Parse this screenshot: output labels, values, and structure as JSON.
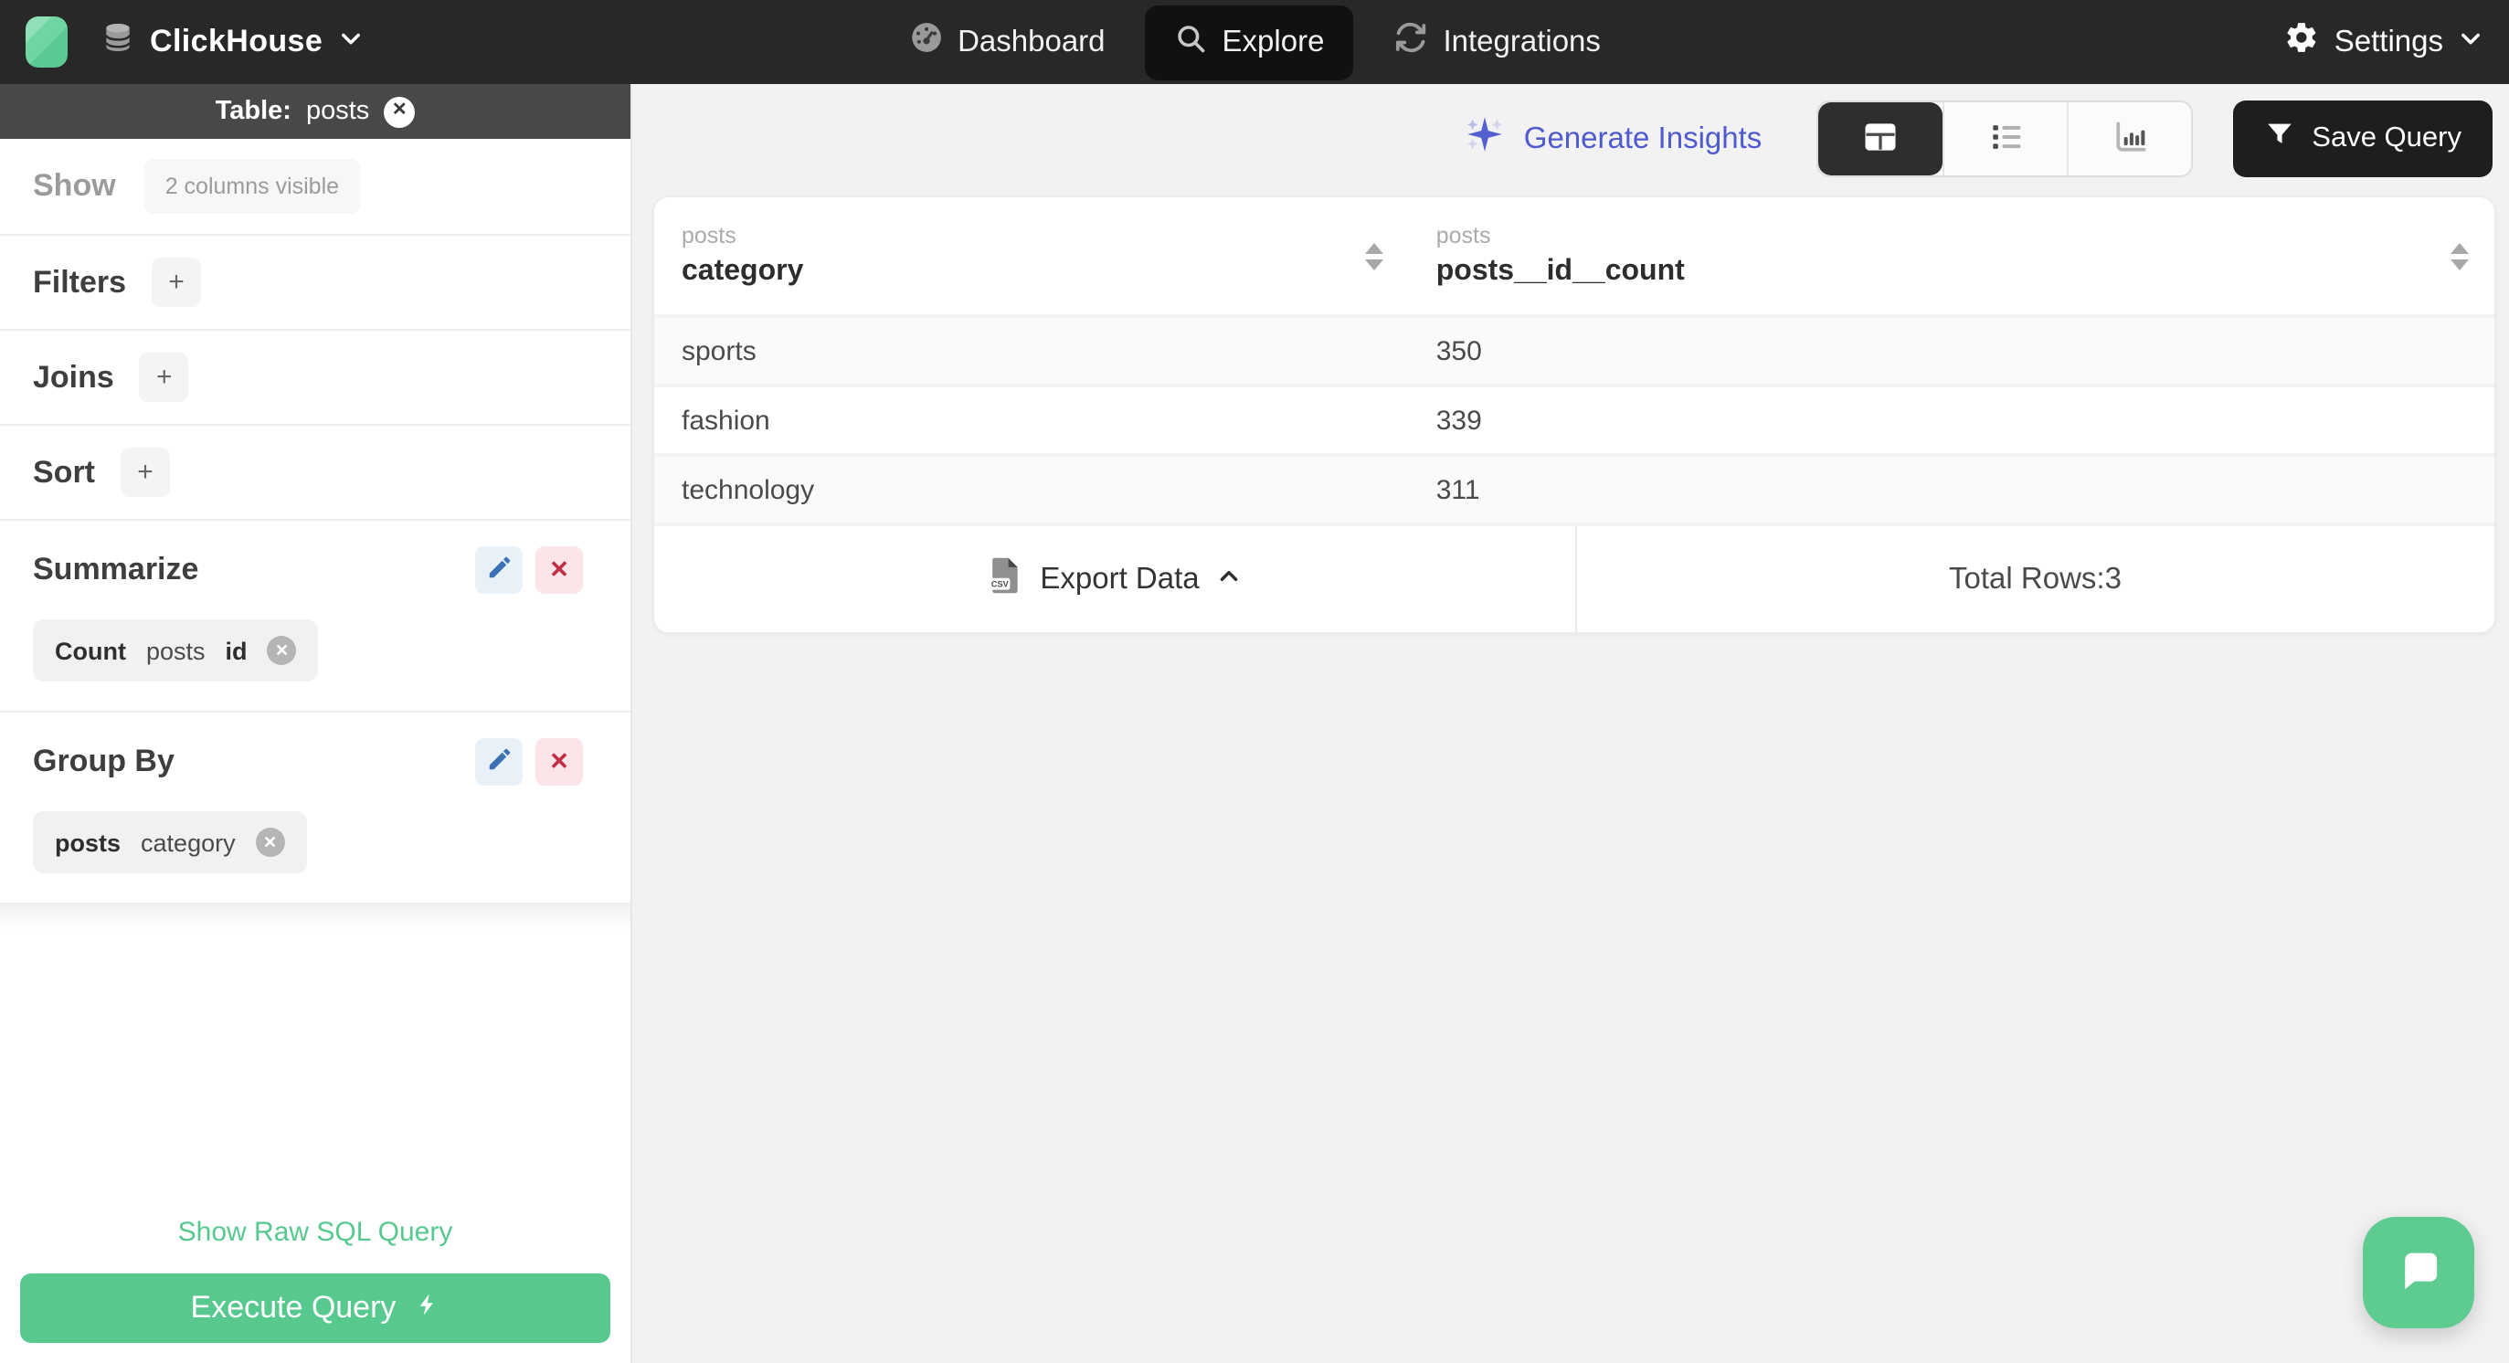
{
  "navbar": {
    "brand": {
      "name": "ClickHouse"
    },
    "items": [
      {
        "label": "Dashboard",
        "icon": "gauge-icon",
        "active": false
      },
      {
        "label": "Explore",
        "icon": "search-icon",
        "active": true
      },
      {
        "label": "Integrations",
        "icon": "sync-icon",
        "active": false
      }
    ],
    "settings_label": "Settings"
  },
  "sidebar": {
    "header": {
      "prefix": "Table:",
      "table": "posts"
    },
    "show": {
      "label": "Show",
      "badge": "2 columns visible"
    },
    "sections": [
      {
        "label": "Filters"
      },
      {
        "label": "Joins"
      },
      {
        "label": "Sort"
      }
    ],
    "plus_glyph": "+",
    "x_glyph": "✕",
    "summarize": {
      "label": "Summarize",
      "chip": {
        "agg": "Count",
        "table": "posts",
        "column": "id"
      }
    },
    "group_by": {
      "label": "Group By",
      "chip": {
        "table": "posts",
        "column": "category"
      }
    },
    "raw_sql_label": "Show Raw SQL Query",
    "execute_label": "Execute Query"
  },
  "toolbar": {
    "generate_insights_label": "Generate Insights",
    "save_query_label": "Save Query"
  },
  "results": {
    "columns": [
      {
        "table": "posts",
        "name": "category"
      },
      {
        "table": "posts",
        "name": "posts__id__count"
      }
    ],
    "rows": [
      [
        "sports",
        "350"
      ],
      [
        "fashion",
        "339"
      ],
      [
        "technology",
        "311"
      ]
    ],
    "export_label": "Export Data",
    "csv_label": "CSV",
    "total_rows_label": "Total Rows:3"
  },
  "colors": {
    "navbar_bg": "#282828",
    "sidebar_header_bg": "#484848",
    "accent_green": "#57c98f",
    "accent_indigo": "#4f5ace",
    "edit_blue": "#3a72b5",
    "delete_red": "#c22f44",
    "main_bg": "#f2f2f2"
  }
}
